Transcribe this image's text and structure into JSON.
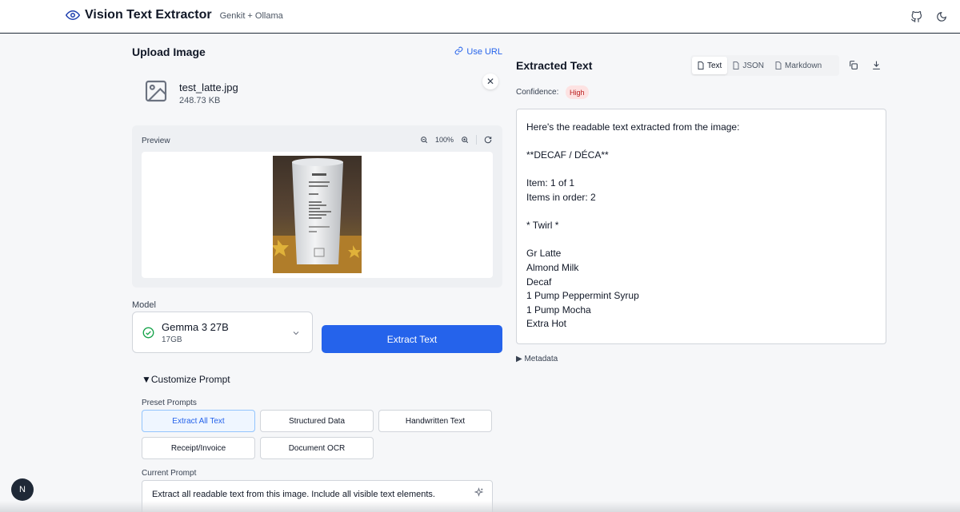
{
  "header": {
    "title": "Vision Text Extractor",
    "subtitle": "Genkit + Ollama",
    "icons": [
      "eye-icon",
      "github-icon",
      "moon-icon"
    ]
  },
  "upload": {
    "heading": "Upload Image",
    "use_url_label": "Use URL",
    "file": {
      "name": "test_latte.jpg",
      "size": "248.73 KB"
    },
    "preview_label": "Preview",
    "zoom_level": "100%"
  },
  "model": {
    "label": "Model",
    "selected_name": "Gemma 3 27B",
    "selected_size": "17GB",
    "status_color": "#16a34a"
  },
  "extract_button": {
    "label": "Extract Text",
    "color": "#2563eb"
  },
  "customize": {
    "toggle_label": "Customize Prompt",
    "preset_label": "Preset Prompts",
    "presets": [
      {
        "label": "Extract All Text",
        "active": true
      },
      {
        "label": "Structured Data",
        "active": false
      },
      {
        "label": "Handwritten Text",
        "active": false
      },
      {
        "label": "Receipt/Invoice",
        "active": false
      },
      {
        "label": "Document OCR",
        "active": false
      }
    ],
    "current_prompt_label": "Current Prompt",
    "current_prompt": "Extract all readable text from this image. Include all visible text elements."
  },
  "result": {
    "heading": "Extracted Text",
    "tabs": [
      {
        "label": "Text",
        "active": true
      },
      {
        "label": "JSON",
        "active": false
      },
      {
        "label": "Markdown",
        "active": false
      }
    ],
    "confidence_label": "Confidence:",
    "confidence_value": "High",
    "lines": [
      "Here's the readable text extracted from the image:",
      "",
      "**DECAF / DÉCA**",
      "",
      "Item: 1 of 1",
      "Items in order: 2",
      "",
      "* Twirl *",
      "",
      "Gr Latte",
      "Almond Milk",
      "Decaf",
      "1 Pump Peppermint Syrup",
      "1 Pump Mocha",
      "Extra Hot"
    ],
    "metadata_label": "Metadata"
  },
  "corner_badge": "N"
}
